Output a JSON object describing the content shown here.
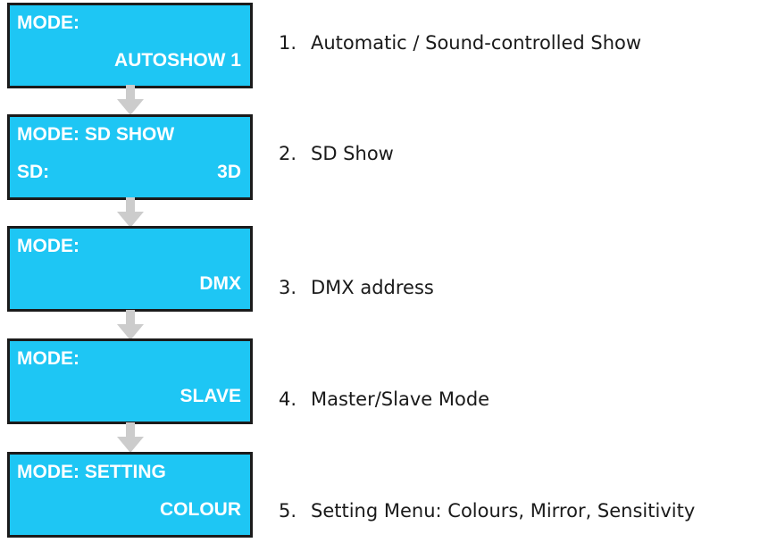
{
  "steps": [
    {
      "display": {
        "line1": "MODE:",
        "line2_left": "",
        "line2_right": "AUTOSHOW 1"
      },
      "number": "1.",
      "description": "Automatic / Sound-controlled Show"
    },
    {
      "display": {
        "line1": "MODE: SD SHOW",
        "line2_left": "SD:",
        "line2_right": "3D"
      },
      "number": "2.",
      "description": "SD Show"
    },
    {
      "display": {
        "line1": "MODE:",
        "line2_left": "",
        "line2_right": "DMX"
      },
      "number": "3.",
      "description": "DMX address"
    },
    {
      "display": {
        "line1": "MODE:",
        "line2_left": "",
        "line2_right": "SLAVE"
      },
      "number": "4.",
      "description": "Master/Slave Mode"
    },
    {
      "display": {
        "line1": "MODE: SETTING",
        "line2_left": "",
        "line2_right": "COLOUR"
      },
      "number": "5.",
      "description": "Setting Menu: Colours, Mirror, Sensitivity"
    }
  ],
  "colors": {
    "lcd_background": "#1ec6f4",
    "lcd_border": "#1b1b1b",
    "lcd_text": "#ffffff",
    "arrow": "#cccccc",
    "label_text": "#1a1a1a"
  }
}
